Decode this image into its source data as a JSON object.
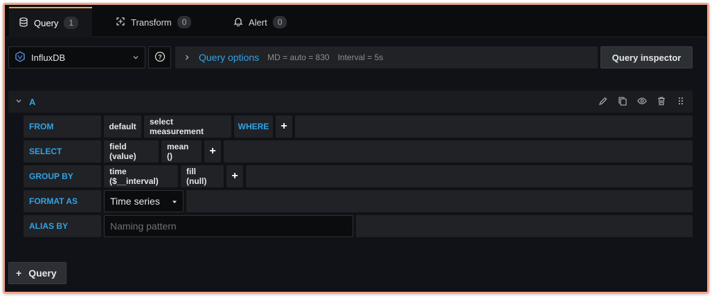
{
  "tabs": [
    {
      "label": "Query",
      "count": "1",
      "icon": "database-icon",
      "active": true
    },
    {
      "label": "Transform",
      "count": "0",
      "icon": "transform-icon",
      "active": false
    },
    {
      "label": "Alert",
      "count": "0",
      "icon": "bell-icon",
      "active": false
    }
  ],
  "datasource": {
    "name": "InfluxDB",
    "icon": "influxdb-icon"
  },
  "help_label": "?",
  "query_options": {
    "title": "Query options",
    "md": "MD = auto = 830",
    "interval": "Interval = 5s"
  },
  "query_inspector": "Query inspector",
  "query": {
    "letter": "A",
    "from": {
      "label": "FROM",
      "policy": "default",
      "measurement": "select measurement",
      "where": "WHERE",
      "plus": "+"
    },
    "select": {
      "label": "SELECT",
      "field": "field (value)",
      "fn": "mean ()",
      "plus": "+"
    },
    "group_by": {
      "label": "GROUP BY",
      "time": "time ($__interval)",
      "fill": "fill (null)",
      "plus": "+"
    },
    "format_as": {
      "label": "FORMAT AS",
      "value": "Time series"
    },
    "alias_by": {
      "label": "ALIAS BY",
      "placeholder": "Naming pattern"
    }
  },
  "add_query": {
    "plus": "+",
    "label": "Query"
  },
  "colors": {
    "accent": "#33a2e5",
    "tab_highlight": "#f7a35c",
    "background": "#111217",
    "frame": "#f4a48c"
  }
}
